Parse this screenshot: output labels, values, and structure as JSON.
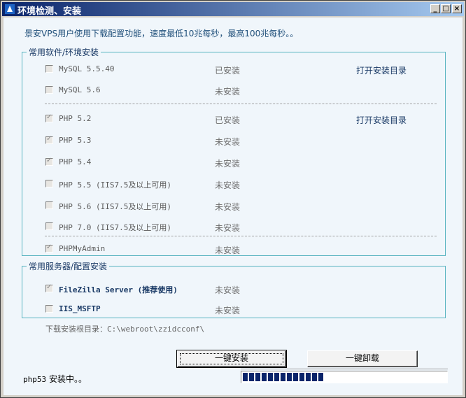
{
  "window": {
    "title": "环境检测、安装",
    "minimize_label": "_",
    "maximize_label": "□",
    "close_label": "×"
  },
  "intro_text": "景安VPS用户使用下载配置功能，速度最低10兆每秒，最高100兆每秒。。",
  "software_group": {
    "title": "常用软件/环境安装",
    "items": [
      {
        "name": "MySQL 5.5.40",
        "status": "已安装",
        "link": "打开安装目录",
        "checked": false
      },
      {
        "name": "MySQL 5.6",
        "status": "未安装",
        "link": "",
        "checked": false
      },
      {
        "name": "PHP 5.2",
        "status": "已安装",
        "link": "打开安装目录",
        "checked": true
      },
      {
        "name": "PHP 5.3",
        "status": "未安装",
        "link": "",
        "checked": true
      },
      {
        "name": "PHP 5.4",
        "status": "未安装",
        "link": "",
        "checked": true
      },
      {
        "name": "PHP 5.5 (IIS7.5及以上可用)",
        "status": "未安装",
        "link": "",
        "checked": false
      },
      {
        "name": "PHP 5.6 (IIS7.5及以上可用)",
        "status": "未安装",
        "link": "",
        "checked": false
      },
      {
        "name": "PHP 7.0 (IIS7.5及以上可用)",
        "status": "未安装",
        "link": "",
        "checked": false
      },
      {
        "name": "PHPMyAdmin",
        "status": "未安装",
        "link": "",
        "checked": true
      }
    ]
  },
  "server_group": {
    "title": "常用服务器/配置安装",
    "items": [
      {
        "name": "FileZilla Server (推荐使用)",
        "status": "未安装",
        "checked": true
      },
      {
        "name": "IIS_MSFTP",
        "status": "未安装",
        "checked": false
      }
    ]
  },
  "download_root": {
    "label": "下载安装根目录：",
    "path": "C:\\webroot\\zzidcconf\\"
  },
  "buttons": {
    "install_all": "一键安装",
    "uninstall_all": "一键卸载"
  },
  "status": {
    "module": "php53",
    "text": " 安装中。。"
  },
  "progress": {
    "fraction": 0.4
  },
  "colors": {
    "accent": "#0a246a",
    "group_border": "#56b3c0",
    "link": "#1a3a66"
  }
}
